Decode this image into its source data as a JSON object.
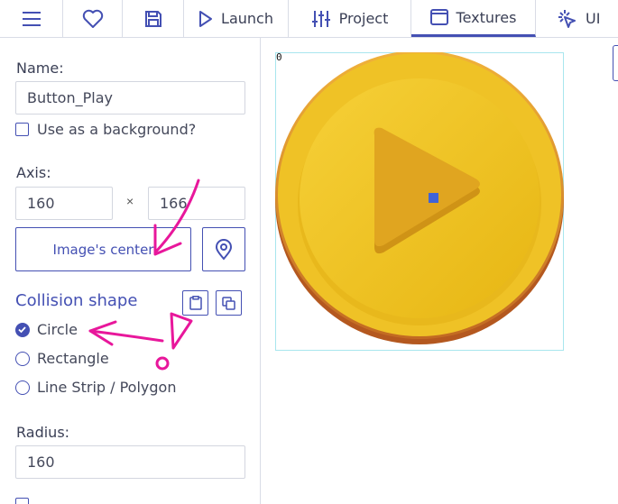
{
  "toolbar": {
    "items": [
      {
        "icon": "menu-icon",
        "label": ""
      },
      {
        "icon": "heart-icon",
        "label": ""
      },
      {
        "icon": "save-icon",
        "label": ""
      },
      {
        "icon": "play-icon",
        "label": "Launch"
      },
      {
        "icon": "sliders-icon",
        "label": "Project"
      },
      {
        "icon": "window-icon",
        "label": "Textures",
        "active": true
      },
      {
        "icon": "cursor-click-icon",
        "label": "UI"
      }
    ]
  },
  "form": {
    "name_label": "Name:",
    "name_value": "Button_Play",
    "background_check_label": "Use as a background?",
    "axis_label": "Axis:",
    "axis_x": "160",
    "axis_separator": "×",
    "axis_y": "166",
    "image_center_button": "Image's center",
    "collision_title": "Collision shape",
    "shapes": [
      "Circle",
      "Rectangle",
      "Line Strip / Polygon"
    ],
    "selected_shape": "Circle",
    "radius_label": "Radius:",
    "radius_value": "160"
  },
  "canvas": {
    "origin_label": "0"
  },
  "colors": {
    "accent": "#4450b3",
    "annotation": "#e8179b",
    "coin_face": "#f2c72e",
    "coin_rim": "#b8621f"
  }
}
